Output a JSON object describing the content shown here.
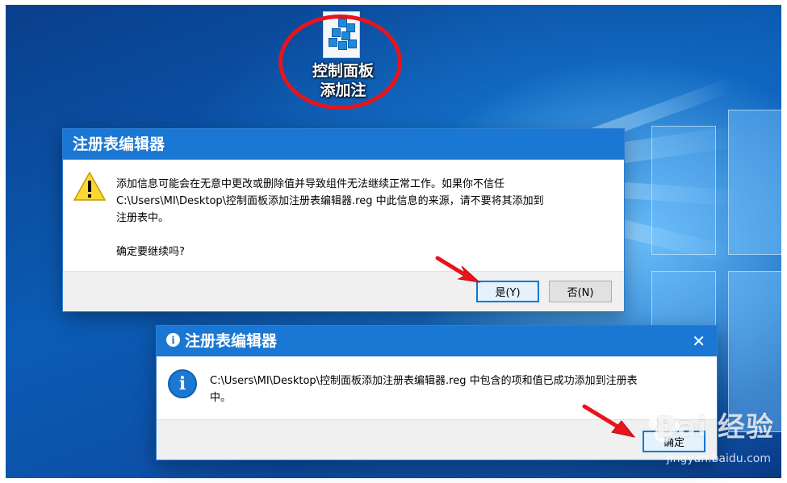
{
  "desktop": {
    "icon_label_line1": "控制面板",
    "icon_label_line2": "添加注",
    "icon_name": "registry-file-icon"
  },
  "dialog_confirm": {
    "title": "注册表编辑器",
    "message_line1": "添加信息可能会在无意中更改或删除值并导致组件无法继续正常工作。如果你不信任",
    "message_line2": "C:\\Users\\MI\\Desktop\\控制面板添加注册表编辑器.reg 中此信息的来源，请不要将其添加到",
    "message_line3": "注册表中。",
    "question": "确定要继续吗?",
    "yes_label": "是(Y)",
    "no_label": "否(N)",
    "icon_name": "warning-icon"
  },
  "dialog_success": {
    "title": "注册表编辑器",
    "message_line1": "C:\\Users\\MI\\Desktop\\控制面板添加注册表编辑器.reg 中包含的项和值已成功添加到注册表",
    "message_line2": "中。",
    "ok_label": "确定",
    "close_glyph": "✕",
    "icon_name": "info-icon"
  },
  "watermark": {
    "brand": "Bai 经验",
    "url": "jingyan.baidu.com"
  },
  "colors": {
    "titlebar": "#1a77d4",
    "highlight_circle": "#e8141c",
    "arrow": "#e8141c",
    "default_button_border": "#0078d7"
  }
}
